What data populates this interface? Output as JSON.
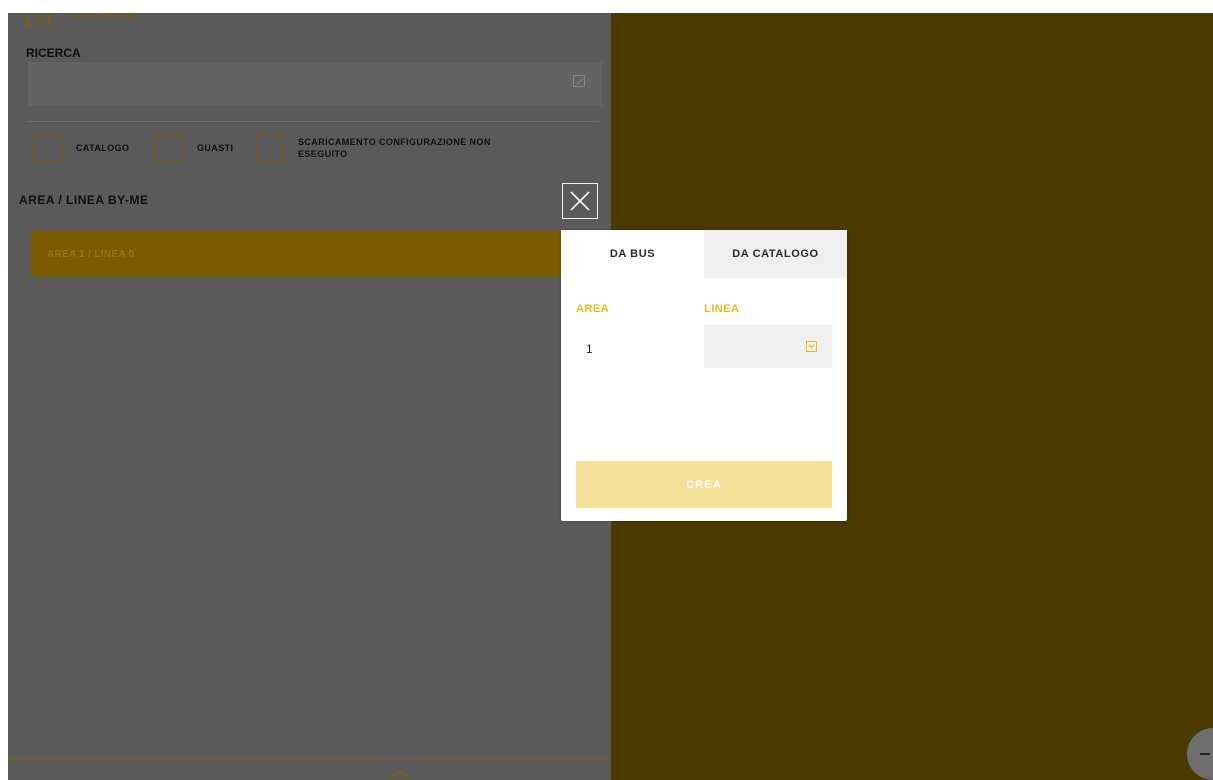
{
  "sidebar": {
    "house_name": "CASA ROSSI",
    "search_label": "RICERCA",
    "search_placeholder": "",
    "filters": [
      {
        "label": "CATALOGO",
        "line2": ""
      },
      {
        "label": "GUASTI",
        "line2": ""
      },
      {
        "label": "SCARICAMENTO CONFIGURAZIONE NON",
        "line2": "ESEGUITO"
      }
    ],
    "section_title": "AREA / LINEA BY-ME",
    "items": [
      {
        "label": "AREA 1 / LINEA 0"
      }
    ]
  },
  "modal": {
    "tabs": [
      {
        "label": "DA BUS",
        "active": true
      },
      {
        "label": "DA CATALOGO",
        "active": false
      }
    ],
    "area_label": "AREA",
    "area_value": "1",
    "linea_label": "LINEA",
    "linea_value": "",
    "create_label": "CREA"
  },
  "icons": {
    "close": "close-icon",
    "edit": "edit-icon",
    "house": "house-location-icon",
    "select": "chevron-down-icon",
    "fab": "minus-icon"
  },
  "colors": {
    "accent": "#e8ba18",
    "overlay_left": "#5a5a5a",
    "overlay_right": "#4a3a00",
    "create_disabled": "#f5e197",
    "area_item": "#7a5c00"
  }
}
